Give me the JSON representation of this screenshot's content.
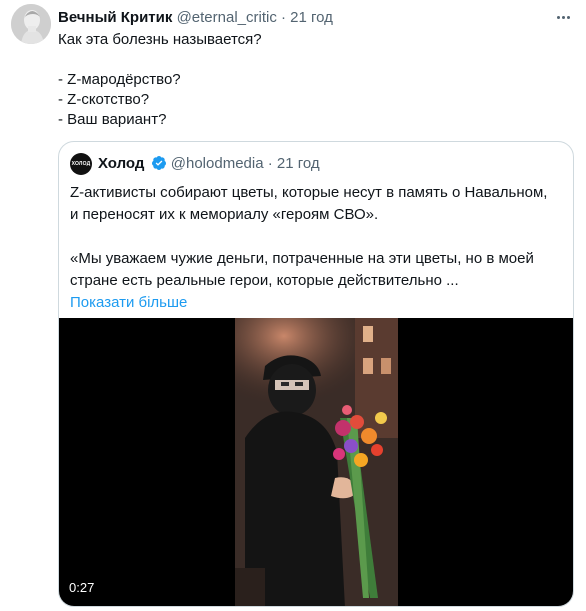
{
  "tweet": {
    "author_name": "Вечный Критик",
    "author_handle": "@eternal_critic",
    "separator": "·",
    "time": "21 год",
    "lines": [
      "Как эта болезнь называется?",
      "",
      "- Z-мародёрство?",
      "- Z-скотство?",
      "- Ваш вариант?"
    ]
  },
  "quoted": {
    "avatar_text": "ХОЛОД",
    "author_name": "Холод",
    "author_handle": "@holodmedia",
    "separator": "·",
    "time": "21 год",
    "lines": [
      "Z-активисты собирают цветы, которые несут в память о Навальном,",
      "и переносят их к мемориалу «героям СВО».",
      "",
      "«Мы уважаем чужие деньги, потраченные на эти цветы, но в моей",
      "стране есть реальные герои, которые действительно ..."
    ],
    "show_more": "Показати більше",
    "video_duration": "0:27"
  },
  "colors": {
    "accent": "#1d9bf0",
    "muted": "#536471",
    "border": "#cfd9de"
  },
  "icons": [
    "more-icon",
    "verified-icon"
  ]
}
